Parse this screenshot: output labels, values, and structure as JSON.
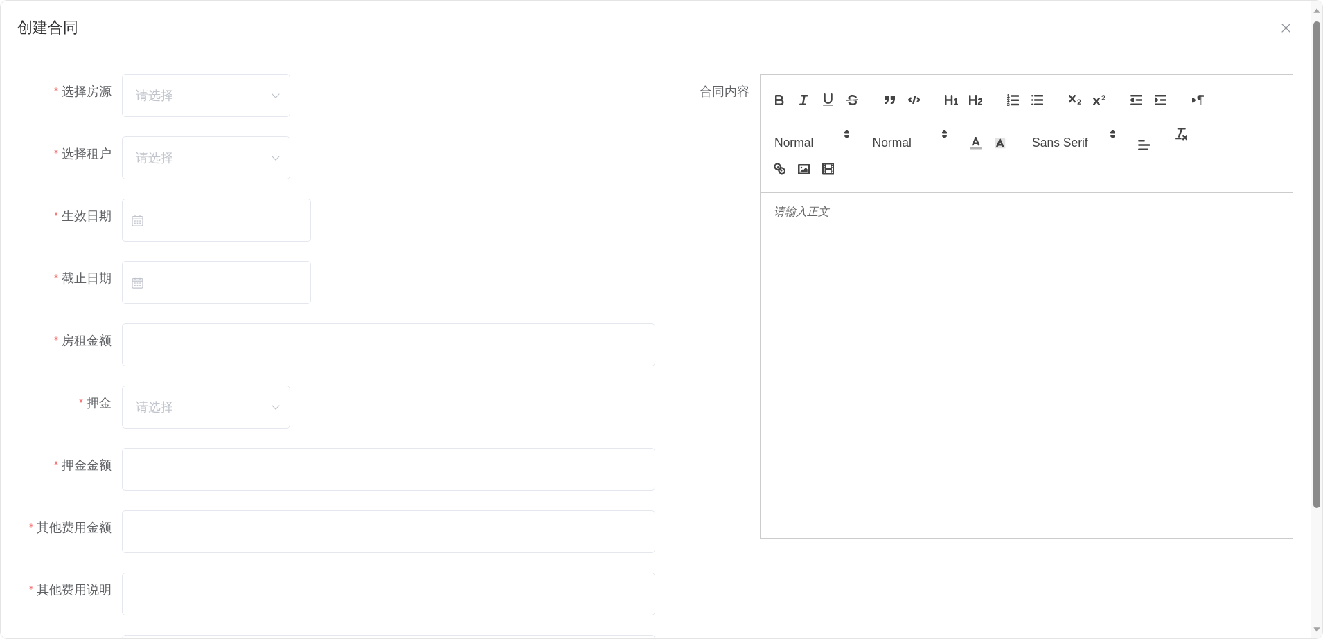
{
  "dialog": {
    "title": "创建合同"
  },
  "form": {
    "fields": [
      {
        "label": "选择房源",
        "required": true,
        "kind": "select",
        "placeholder": "请选择"
      },
      {
        "label": "选择租户",
        "required": true,
        "kind": "select",
        "placeholder": "请选择"
      },
      {
        "label": "生效日期",
        "required": true,
        "kind": "date"
      },
      {
        "label": "截止日期",
        "required": true,
        "kind": "date"
      },
      {
        "label": "房租金额",
        "required": true,
        "kind": "input"
      },
      {
        "label": "押金",
        "required": true,
        "kind": "select",
        "placeholder": "请选择"
      },
      {
        "label": "押金金额",
        "required": true,
        "kind": "input"
      },
      {
        "label": "其他费用金额",
        "required": true,
        "kind": "input"
      },
      {
        "label": "其他费用说明",
        "required": true,
        "kind": "input"
      },
      {
        "kind": "input"
      }
    ]
  },
  "editor": {
    "label": "合同内容",
    "pickers": [
      {
        "value": "Normal"
      },
      {
        "value": "Normal"
      },
      {
        "value": "Sans Serif"
      }
    ],
    "placeholder": "请输入正文"
  }
}
